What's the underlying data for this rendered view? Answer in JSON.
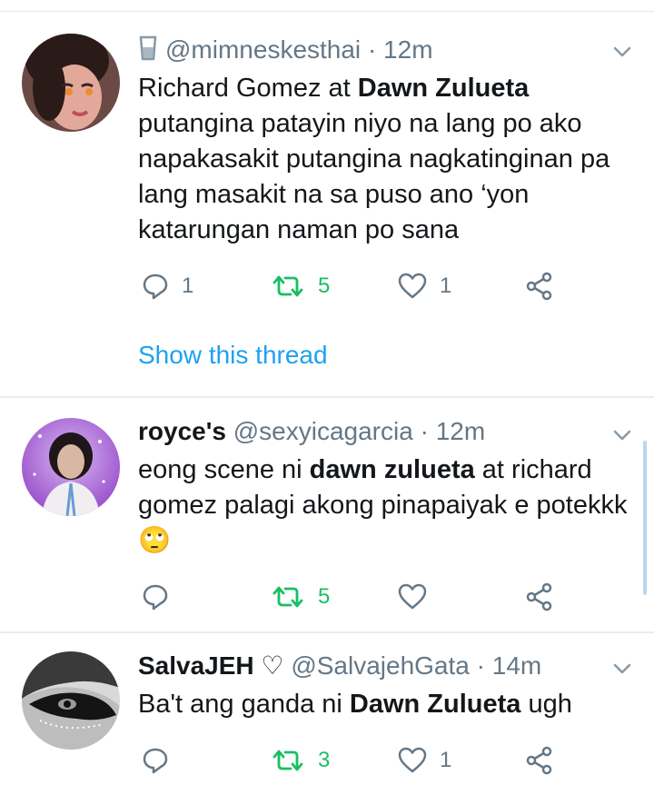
{
  "tweets": [
    {
      "handle": "@mimneskesthai",
      "time": "12m",
      "body": {
        "t1": "Richard Gomez at ",
        "b1": "Dawn Zulueta",
        "t2": " putangina patayin niyo na lang po ako napakasakit putangina nagkatinginan pa lang masakit na sa puso ano ‘yon katarungan naman po sana"
      },
      "reply_count": "1",
      "retweet_count": "5",
      "like_count": "1",
      "show_thread": "Show this thread"
    },
    {
      "name": "royce's",
      "handle": "@sexyicagarcia",
      "time": "12m",
      "body": {
        "t1": "eong scene ni ",
        "b1": "dawn zulueta",
        "t2": " at richard gomez palagi akong pinapaiyak e potekkk ",
        "emoji": "🙄"
      },
      "reply_count": "",
      "retweet_count": "5",
      "like_count": ""
    },
    {
      "name": "SalvaJEH",
      "name_symbol": "♡",
      "handle": "@SalvajehGata",
      "time": "14m",
      "body": {
        "t1": "Ba't ang ganda ni ",
        "b1": "Dawn Zulueta",
        "t2": " ugh"
      },
      "reply_count": "",
      "retweet_count": "3",
      "like_count": "1"
    }
  ],
  "separator": "·",
  "icons": {
    "reply": "reply-bubble-icon",
    "retweet": "retweet-icon",
    "like": "heart-icon",
    "share": "share-icon",
    "caret": "chevron-down-icon"
  },
  "colors": {
    "accent": "#1da1f2",
    "retweet": "#17bf63",
    "muted": "#657786",
    "text": "#14171a",
    "divider": "#e6ecf0"
  }
}
